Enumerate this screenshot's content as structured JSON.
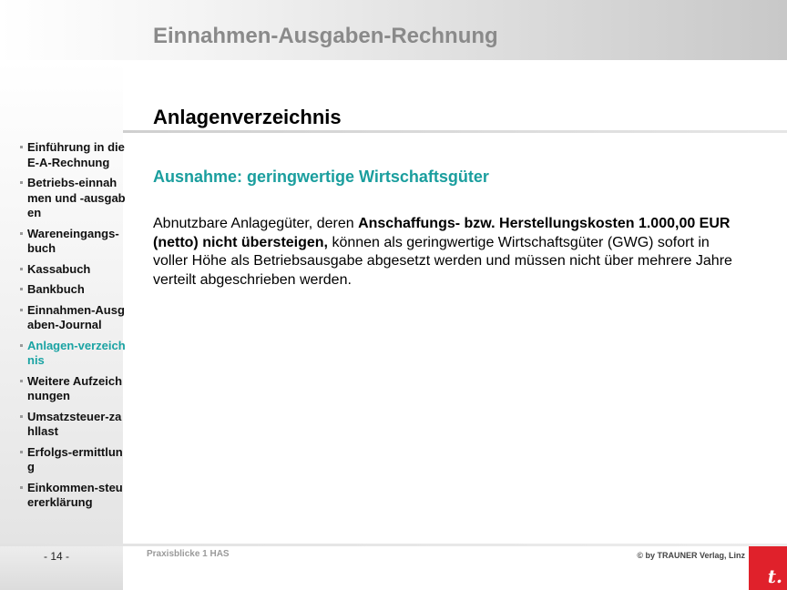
{
  "header": {
    "title": "Einnahmen-Ausgaben-Rechnung"
  },
  "sidebar": {
    "items": [
      {
        "label": "Einführung in die E-A-Rechnung",
        "active": false
      },
      {
        "label": "Betriebs-einnahmen und -ausgaben",
        "active": false
      },
      {
        "label": "Wareneingangs-buch",
        "active": false
      },
      {
        "label": "Kassabuch",
        "active": false
      },
      {
        "label": "Bankbuch",
        "active": false
      },
      {
        "label": "Einnahmen-Ausgaben-Journal",
        "active": false
      },
      {
        "label": "Anlagen-verzeichnis",
        "active": true
      },
      {
        "label": "Weitere Aufzeichnungen",
        "active": false
      },
      {
        "label": "Umsatzsteuer-zahllast",
        "active": false
      },
      {
        "label": "Erfolgs-ermittlung",
        "active": false
      },
      {
        "label": "Einkommen-steuererklärung",
        "active": false
      }
    ]
  },
  "main": {
    "title": "Anlagenverzeichnis",
    "subheading": "Ausnahme: geringwertige Wirtschaftsgüter",
    "body": {
      "before": "Abnutzbare Anlagegüter, deren ",
      "bold": "Anschaffungs- bzw. Herstellungskosten 1.000,00 EUR (netto) nicht übersteigen,",
      "after": " können als geringwertige Wirtschaftsgüter (GWG) sofort in voller Höhe als Betriebsausgabe abgesetzt werden und müssen nicht über mehrere Jahre verteilt abgeschrieben werden."
    }
  },
  "footer": {
    "page_number": "- 14 -",
    "course": "Praxisblicke 1 HAS",
    "copyright": "© by TRAUNER Verlag, Linz",
    "logo_letter": "t."
  },
  "colors": {
    "accent": "#1a9e9e",
    "logo_red": "#e0212b"
  }
}
